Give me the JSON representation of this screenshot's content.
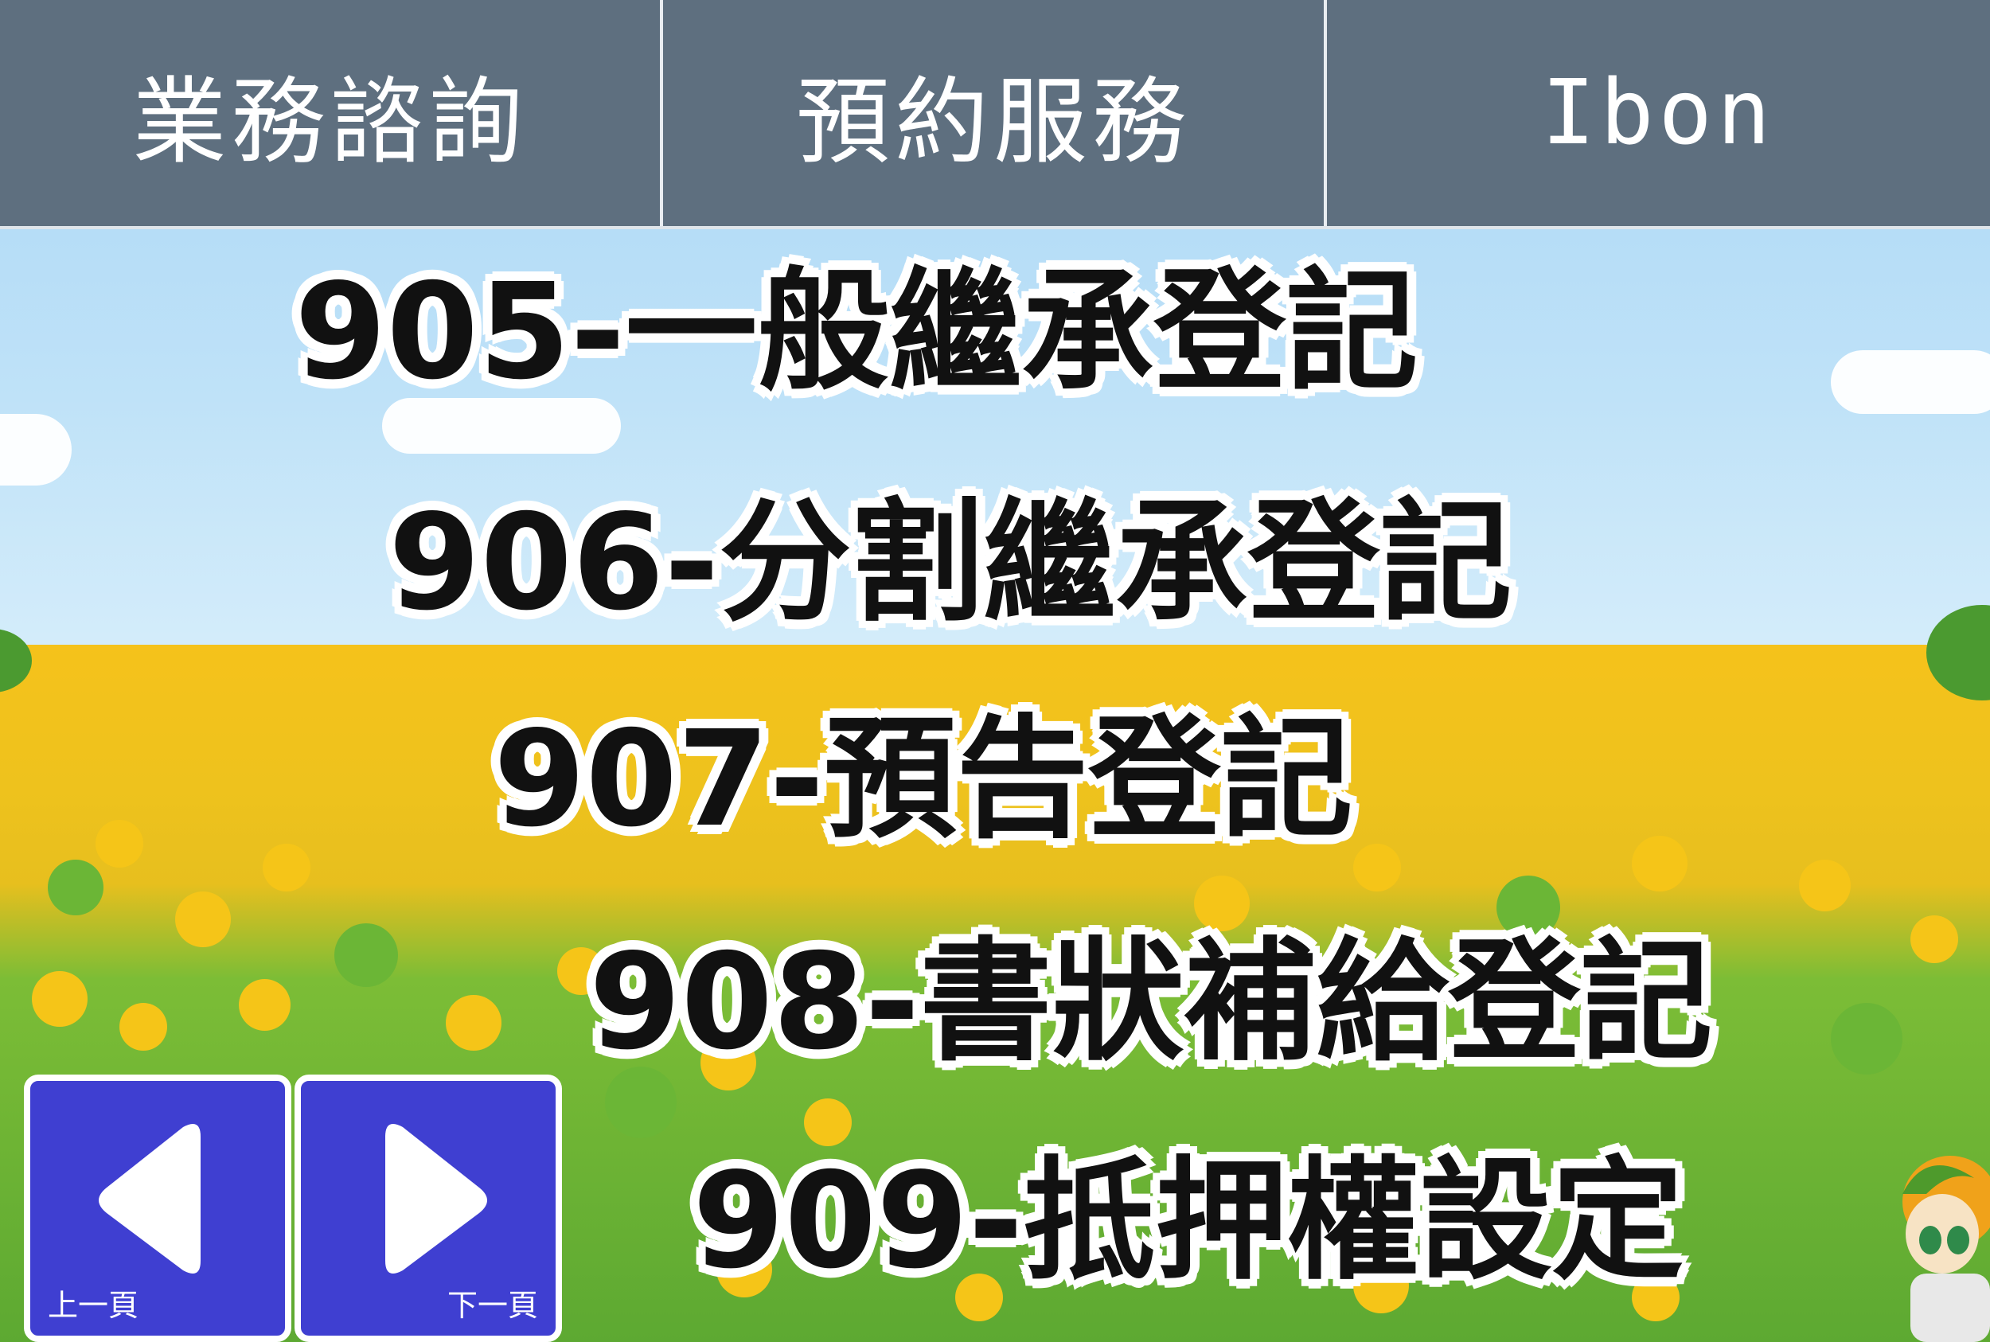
{
  "nav": {
    "tabs": [
      {
        "label": "業務諮詢"
      },
      {
        "label": "預約服務"
      },
      {
        "label": "Ibon"
      }
    ]
  },
  "services": [
    {
      "label": "905-一般繼承登記"
    },
    {
      "label": "906-分割繼承登記"
    },
    {
      "label": "907-預告登記"
    },
    {
      "label": "908-書狀補給登記"
    },
    {
      "label": "909-抵押權設定"
    }
  ],
  "pager": {
    "prev_label": "上一頁",
    "next_label": "下一頁",
    "prev_icon": "triangle-left-icon",
    "next_icon": "triangle-right-icon"
  },
  "colors": {
    "nav_bg": "#5e6f7f",
    "button_bg": "#3f3fd1",
    "sky": "#bfe2f8",
    "flower": "#f5c518",
    "grass": "#5da932"
  }
}
